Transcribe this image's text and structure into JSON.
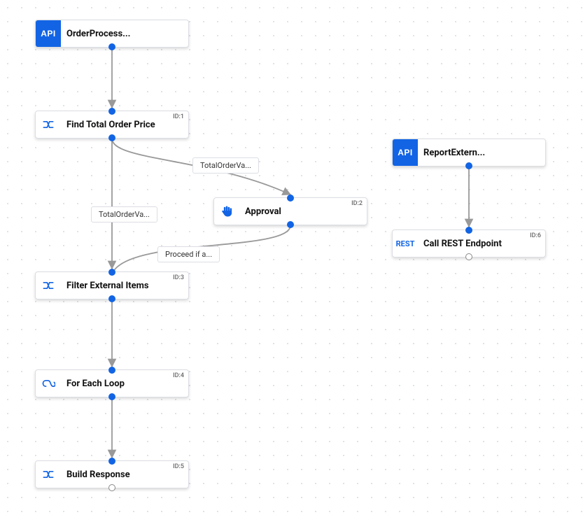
{
  "nodes": {
    "orderProcess": {
      "label": "OrderProcess...",
      "iconText": "API"
    },
    "findTotal": {
      "label": "Find Total Order Price",
      "id": "ID:1"
    },
    "approval": {
      "label": "Approval",
      "id": "ID:2"
    },
    "filterExternal": {
      "label": "Filter External Items",
      "id": "ID:3"
    },
    "forEach": {
      "label": "For Each Loop",
      "id": "ID:4"
    },
    "buildResponse": {
      "label": "Build Response",
      "id": "ID:5"
    },
    "reportExtern": {
      "label": "ReportExtern...",
      "iconText": "API"
    },
    "callRest": {
      "label": "Call REST Endpoint",
      "id": "ID:6",
      "iconText": "REST"
    }
  },
  "edgeLabels": {
    "totalOrderVa1": "TotalOrderVa...",
    "totalOrderVa2": "TotalOrderVa...",
    "proceedIfA": "Proceed if a..."
  }
}
